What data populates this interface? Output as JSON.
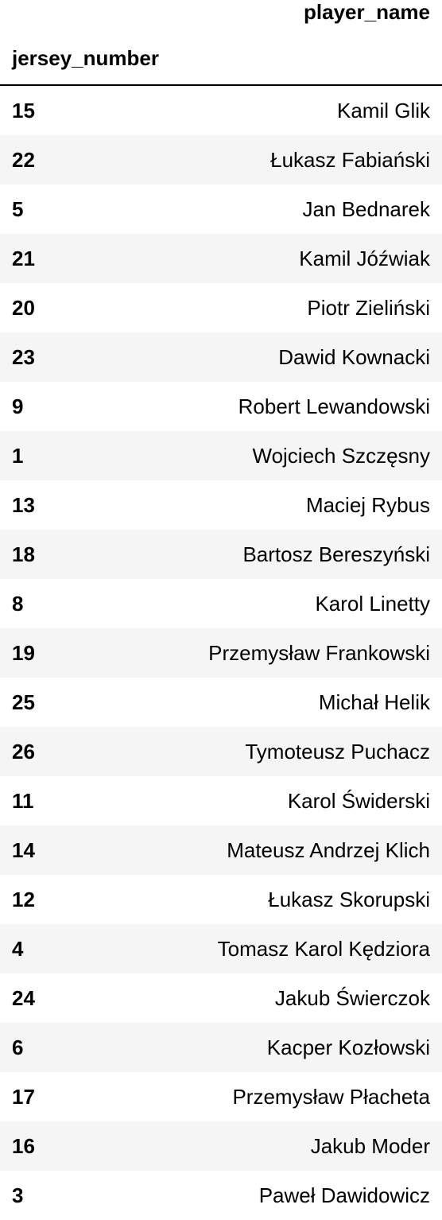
{
  "table": {
    "column_header": "player_name",
    "index_header": "jersey_number",
    "rows": [
      {
        "jersey_number": "15",
        "player_name": "Kamil Glik"
      },
      {
        "jersey_number": "22",
        "player_name": "Łukasz Fabiański"
      },
      {
        "jersey_number": "5",
        "player_name": "Jan Bednarek"
      },
      {
        "jersey_number": "21",
        "player_name": "Kamil Jóźwiak"
      },
      {
        "jersey_number": "20",
        "player_name": "Piotr Zieliński"
      },
      {
        "jersey_number": "23",
        "player_name": "Dawid Kownacki"
      },
      {
        "jersey_number": "9",
        "player_name": "Robert Lewandowski"
      },
      {
        "jersey_number": "1",
        "player_name": "Wojciech Szczęsny"
      },
      {
        "jersey_number": "13",
        "player_name": "Maciej Rybus"
      },
      {
        "jersey_number": "18",
        "player_name": "Bartosz Bereszyński"
      },
      {
        "jersey_number": "8",
        "player_name": "Karol Linetty"
      },
      {
        "jersey_number": "19",
        "player_name": "Przemysław Frankowski"
      },
      {
        "jersey_number": "25",
        "player_name": "Michał Helik"
      },
      {
        "jersey_number": "26",
        "player_name": "Tymoteusz Puchacz"
      },
      {
        "jersey_number": "11",
        "player_name": "Karol Świderski"
      },
      {
        "jersey_number": "14",
        "player_name": "Mateusz Andrzej Klich"
      },
      {
        "jersey_number": "12",
        "player_name": "Łukasz Skorupski"
      },
      {
        "jersey_number": "4",
        "player_name": "Tomasz Karol Kędziora"
      },
      {
        "jersey_number": "24",
        "player_name": "Jakub Świerczok"
      },
      {
        "jersey_number": "6",
        "player_name": "Kacper Kozłowski"
      },
      {
        "jersey_number": "17",
        "player_name": "Przemysław Płacheta"
      },
      {
        "jersey_number": "16",
        "player_name": "Jakub Moder"
      },
      {
        "jersey_number": "3",
        "player_name": "Paweł Dawidowicz"
      }
    ]
  }
}
